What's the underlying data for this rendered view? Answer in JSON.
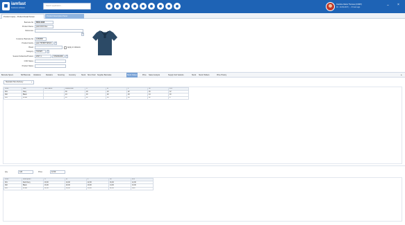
{
  "app": {
    "logo_name": "iamfast",
    "logo_sub": "business software",
    "search_placeholder": "Search application...",
    "quick_icons": [
      "home-icon",
      "user-icon",
      "chart-icon",
      "cart-icon",
      "box-icon",
      "doc-icon",
      "mail-icon",
      "bell-icon",
      "settings-icon"
    ],
    "user_name": "Caroline Marie Thomas (CORP)",
    "user_detail": "02 - 10-09-2017 | ... 3 hours ago",
    "brand_color": "#1e63b5"
  },
  "tabs": [
    "Product Inquiry - Product Detail Screen",
    "Product Description Panel"
  ],
  "form": {
    "fields": [
      {
        "label": "Barcode No",
        "value": "RJGI-1198"
      },
      {
        "label": "Product Name",
        "value": "polo tshirt blue"
      },
      {
        "label": "Reference",
        "value": ""
      },
      {
        "label": "Customer Barcode No",
        "value": "1254896"
      },
      {
        "label": "Product Family",
        "value": "polo TSHIRT BASIC"
      },
      {
        "label": "Brand",
        "value": "",
        "checkbox_label": "Apply to Variants"
      },
      {
        "label": "Category",
        "value": "TSHIRT"
      },
      {
        "label": "Season/Collection/Product",
        "value": "2017-1",
        "extra": "STANDARD"
      },
      {
        "label": "COD Status",
        "value": ""
      },
      {
        "label": "Product Status",
        "value": ""
      }
    ]
  },
  "main_tabs": [
    "Barcode Specs",
    "SM Barcode",
    "Variations",
    "Retailers",
    "Sourcing",
    "Inventory",
    "Stock",
    "Size Chart",
    "Supplier Barcodes",
    "Specification Product",
    "Stock Values",
    "Price",
    "Sales Analysis",
    "Supply Sub Variants",
    "Stock",
    "Stock Holders",
    "Price History"
  ],
  "active_main_tab": "Stock Values",
  "grid1": {
    "select_value": "Standard Size Delivery",
    "headers": [
      "Color",
      "Size",
      "Size Name",
      "Warehouse",
      "S",
      "M",
      "L",
      "XL",
      "2XL"
    ],
    "rows": [
      [
        "001",
        "Navy",
        "",
        "30",
        "18",
        "24",
        "22",
        "16",
        "12"
      ],
      [
        "002",
        "Black",
        "",
        "24",
        "16",
        "20",
        "18",
        "14",
        "10"
      ],
      [
        "003",
        "White",
        "",
        "20",
        "12",
        "18",
        "16",
        "12",
        "8"
      ]
    ]
  },
  "bottom_bar": {
    "label1": "Qty",
    "value1": "120",
    "label2": "Price",
    "value2": "12.50"
  },
  "grid2": {
    "headers": [
      "Color",
      "Description",
      "S",
      "M",
      "L",
      "XL",
      "2XL"
    ],
    "rows": [
      [
        "001",
        "Dark Navy",
        "18,00",
        "24,00",
        "22,00",
        "16,00",
        "12,00"
      ],
      [
        "002",
        "Black",
        "16,00",
        "20,00",
        "18,00",
        "14,00",
        "10,00"
      ],
      [
        "003",
        "White",
        "12,00",
        "18,00",
        "16,00",
        "12,00",
        "8,00"
      ]
    ]
  }
}
